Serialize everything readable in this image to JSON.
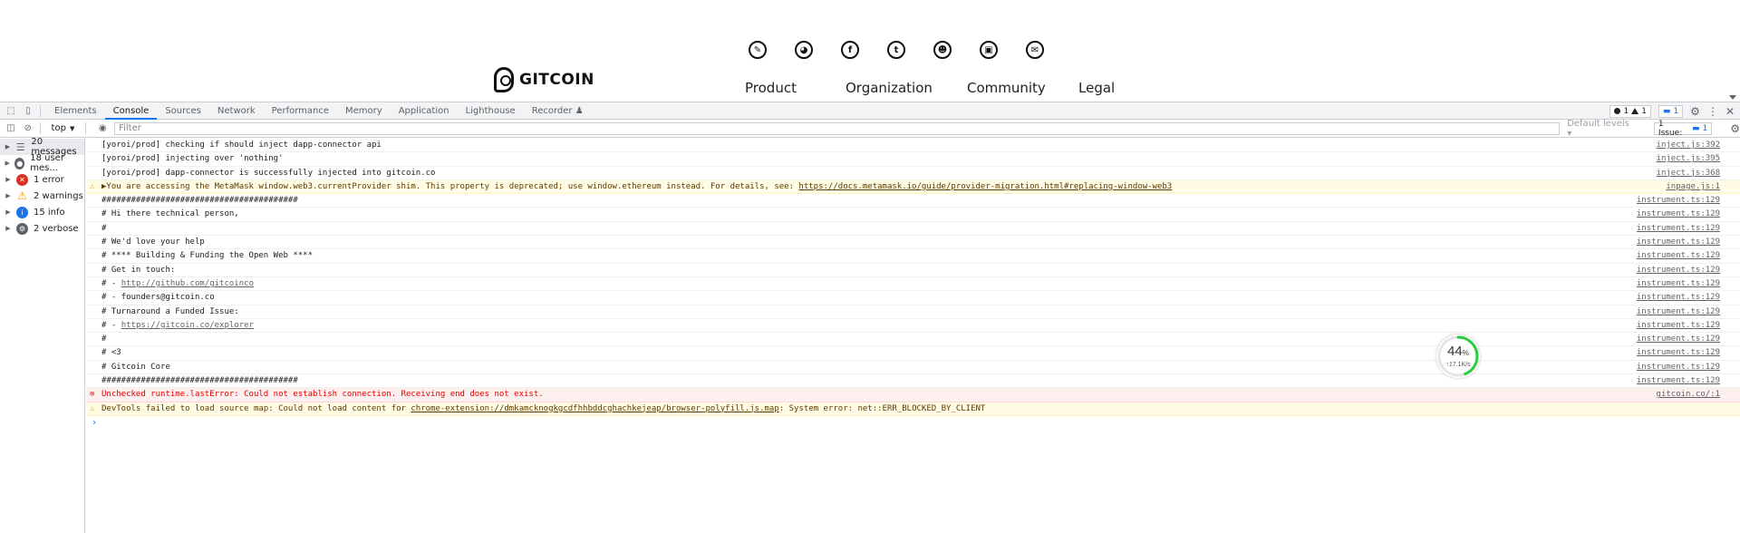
{
  "page": {
    "social_icons": [
      "blog-icon",
      "github-icon",
      "facebook-icon",
      "twitter-icon",
      "reddit-icon",
      "youtube-icon",
      "email-icon"
    ],
    "logo_text": "GITCOIN",
    "footer_nav": [
      "Product",
      "Organization",
      "Community",
      "Legal"
    ]
  },
  "devtools": {
    "tabs": [
      "Elements",
      "Console",
      "Sources",
      "Network",
      "Performance",
      "Memory",
      "Application",
      "Lighthouse",
      "Recorder"
    ],
    "active_tab": "Console",
    "errors_count": "1",
    "warnings_count": "1",
    "messages_count": "1",
    "context": "top",
    "filter_placeholder": "Filter",
    "levels_label": "Default levels",
    "issues_label": "1 Issue:",
    "issues_count": "1"
  },
  "sidebar": [
    {
      "label": "20 messages",
      "icon": "list-icon"
    },
    {
      "label": "18 user mes...",
      "icon": "user-icon"
    },
    {
      "label": "1 error",
      "icon": "error-icon"
    },
    {
      "label": "2 warnings",
      "icon": "warning-icon"
    },
    {
      "label": "15 info",
      "icon": "info-icon"
    },
    {
      "label": "2 verbose",
      "icon": "verbose-icon"
    }
  ],
  "console_rows": [
    {
      "text": "[yoroi/prod] checking if should inject dapp-connector api",
      "src": "inject.js:392",
      "level": "log"
    },
    {
      "text": "[yoroi/prod] injecting over 'nothing'",
      "src": "inject.js:395",
      "level": "log"
    },
    {
      "text": "[yoroi/prod] dapp-connector is successfully injected into gitcoin.co",
      "src": "inject.js:368",
      "level": "log"
    },
    {
      "text": "▶You are accessing the MetaMask window.web3.currentProvider shim. This property is deprecated; use window.ethereum instead. For details, see: ",
      "link": "https://docs.metamask.io/guide/provider-migration.html#replacing-window-web3",
      "src": "inpage.js:1",
      "level": "warn"
    },
    {
      "text": "########################################",
      "src": "instrument.ts:129",
      "level": "log"
    },
    {
      "text": "# Hi there technical person,",
      "src": "instrument.ts:129",
      "level": "log"
    },
    {
      "text": "#",
      "src": "instrument.ts:129",
      "level": "log"
    },
    {
      "text": "# We'd love your help",
      "src": "instrument.ts:129",
      "level": "log"
    },
    {
      "text": "# **** Building & Funding the Open Web ****",
      "src": "instrument.ts:129",
      "level": "log"
    },
    {
      "text": "# Get in touch:",
      "src": "instrument.ts:129",
      "level": "log"
    },
    {
      "text": "# - ",
      "link": "http://github.com/gitcoinco",
      "src": "instrument.ts:129",
      "level": "log"
    },
    {
      "text": "# - founders@gitcoin.co",
      "src": "instrument.ts:129",
      "level": "log"
    },
    {
      "text": "# Turnaround a Funded Issue:",
      "src": "instrument.ts:129",
      "level": "log"
    },
    {
      "text": "# - ",
      "link": "https://gitcoin.co/explorer",
      "src": "instrument.ts:129",
      "level": "log"
    },
    {
      "text": "#",
      "src": "instrument.ts:129",
      "level": "log"
    },
    {
      "text": "# <3",
      "src": "instrument.ts:129",
      "level": "log"
    },
    {
      "text": "# Gitcoin Core",
      "src": "instrument.ts:129",
      "level": "log"
    },
    {
      "text": "########################################",
      "src": "instrument.ts:129",
      "level": "log"
    },
    {
      "text": "Unchecked runtime.lastError: Could not establish connection. Receiving end does not exist.",
      "src": "gitcoin.co/:1",
      "level": "error"
    },
    {
      "text": "DevTools failed to load source map: Could not load content for ",
      "link": "chrome-extension://dmkamcknogkgcdfhhbddcghachkejeap/browser-polyfill.js.map",
      "after": ": System error: net::ERR_BLOCKED_BY_CLIENT",
      "src": "",
      "level": "warn"
    }
  ],
  "gauge": {
    "percent_value": 44,
    "percent": "44",
    "percent_unit": "%",
    "speed": "↑17.1K/s"
  }
}
